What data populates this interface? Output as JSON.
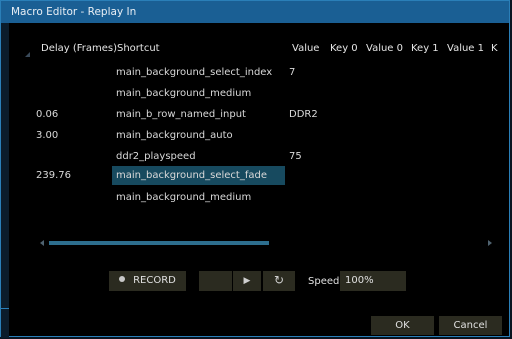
{
  "window": {
    "title": "Macro Editor - Replay In"
  },
  "columns": [
    "Delay (Frames)",
    "Shortcut",
    "Value",
    "Key 0",
    "Value 0",
    "Key 1",
    "Value 1",
    "K"
  ],
  "rows": [
    {
      "delay": "",
      "shortcut": "main_background_select_index",
      "value": "7"
    },
    {
      "delay": "",
      "shortcut": "main_background_medium",
      "value": ""
    },
    {
      "delay": "0.06",
      "shortcut": "main_b_row_named_input",
      "value": "DDR2"
    },
    {
      "delay": "3.00",
      "shortcut": "main_background_auto",
      "value": ""
    },
    {
      "delay": "",
      "shortcut": "ddr2_playspeed",
      "value": "75"
    },
    {
      "delay": "239.76",
      "shortcut": "main_background_select_fade",
      "value": "",
      "selected": true
    },
    {
      "delay": "",
      "shortcut": "main_background_medium",
      "value": ""
    }
  ],
  "controls": {
    "record_label": "RECORD",
    "play_icon": "▶",
    "loop_icon": "↻",
    "speed_label": "Speed",
    "speed_value": "100%"
  },
  "dialog": {
    "ok_label": "OK",
    "cancel_label": "Cancel"
  },
  "colors": {
    "title_bar": "#1a5f94",
    "selection": "#174a5f",
    "button_bg": "#2b2b20",
    "scrollbar": "#2d6e8e"
  }
}
